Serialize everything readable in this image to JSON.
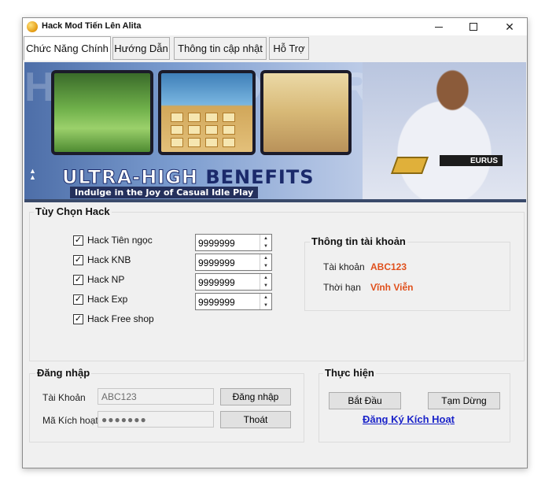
{
  "window": {
    "title": "Hack Mod Tiến Lên Alita"
  },
  "tabs": [
    {
      "label": "Chức Năng Chính",
      "active": true
    },
    {
      "label": "Hướng Dẫn",
      "active": false
    },
    {
      "label": "Thông tin cập nhật",
      "active": false
    },
    {
      "label": "Hỗ Trợ",
      "active": false
    }
  ],
  "banner": {
    "headline_part1": "ULTRA-HIGH",
    "headline_part2": " BENEFITS",
    "subline": "Indulge in the Joy of Casual Idle Play",
    "brand": "EURUS",
    "strip_text": "HEROES OF CROWN LEGENDS"
  },
  "hack_options": {
    "legend": "Tùy Chọn Hack",
    "items": [
      {
        "label": "Hack Tiên ngọc",
        "checked": true,
        "value": "9999999"
      },
      {
        "label": "Hack KNB",
        "checked": true,
        "value": "9999999"
      },
      {
        "label": "Hack NP",
        "checked": true,
        "value": "9999999"
      },
      {
        "label": "Hack Exp",
        "checked": true,
        "value": "9999999"
      },
      {
        "label": "Hack Free shop",
        "checked": true
      }
    ]
  },
  "account_info": {
    "legend": "Thông tin tài khoản",
    "account_label": "Tài khoản",
    "account_value": "ABC123",
    "duration_label": "Thời hạn",
    "duration_value": "Vĩnh Viễn"
  },
  "login": {
    "legend": "Đăng nhập",
    "account_label": "Tài Khoản",
    "account_value": "ABC123",
    "code_label": "Mã Kích hoạt",
    "code_value": "●●●●●●●",
    "login_button": "Đăng nhập",
    "exit_button": "Thoát"
  },
  "execute": {
    "legend": "Thực hiện",
    "start_button": "Bắt Đầu",
    "pause_button": "Tạm Dừng",
    "register_link": "Đăng Ký Kích Hoạt"
  },
  "colors": {
    "accent_value": "#e0501c",
    "link": "#1a23c9"
  }
}
